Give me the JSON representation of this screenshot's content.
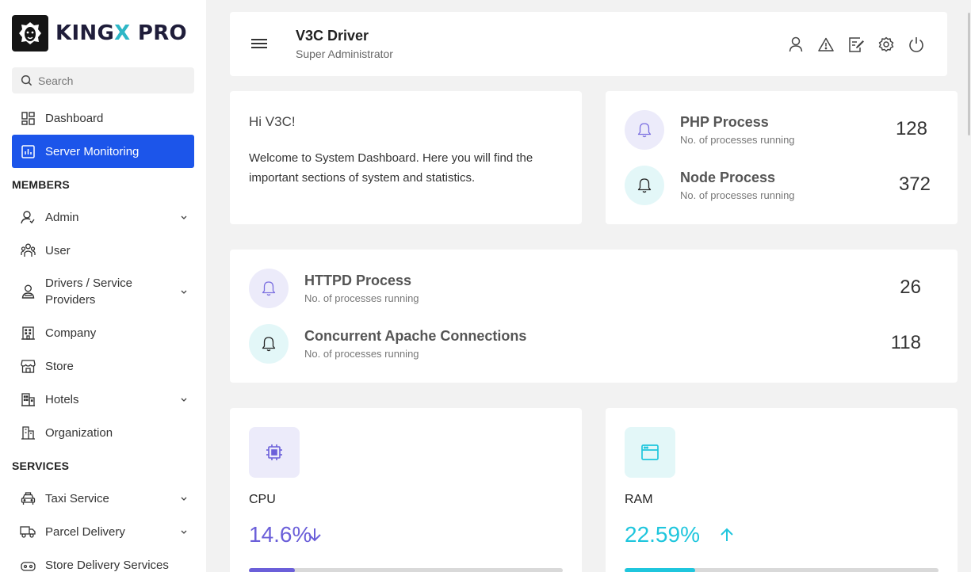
{
  "brand": {
    "name_part1": "KING",
    "name_part2": "X",
    "name_part3": " PRO"
  },
  "search": {
    "placeholder": "Search"
  },
  "sidebar": {
    "items": [
      {
        "label": "Dashboard",
        "icon": "dashboard-icon"
      },
      {
        "label": "Server Monitoring",
        "icon": "chart-icon",
        "active": true
      }
    ],
    "members_title": "MEMBERS",
    "members": [
      {
        "label": "Admin",
        "icon": "admin-icon",
        "expandable": true
      },
      {
        "label": "User",
        "icon": "users-icon"
      },
      {
        "label_line1": "Drivers / Service",
        "label_line2": "Providers",
        "icon": "driver-icon",
        "expandable": true
      },
      {
        "label": "Company",
        "icon": "building-icon"
      },
      {
        "label": "Store",
        "icon": "store-icon"
      },
      {
        "label": "Hotels",
        "icon": "hotel-icon",
        "expandable": true
      },
      {
        "label": "Organization",
        "icon": "organization-icon"
      }
    ],
    "services_title": "SERVICES",
    "services": [
      {
        "label": "Taxi Service",
        "icon": "taxi-icon",
        "expandable": true
      },
      {
        "label": "Parcel Delivery",
        "icon": "truck-icon",
        "expandable": true
      },
      {
        "label": "Store Delivery Services",
        "icon": "delivery-icon",
        "expandable": true
      }
    ]
  },
  "header": {
    "user_name": "V3C Driver",
    "user_role": "Super Administrator",
    "icons": [
      "profile-icon",
      "alert-icon",
      "edit-icon",
      "settings-icon",
      "power-icon"
    ]
  },
  "welcome": {
    "greeting": "Hi V3C!",
    "message": "Welcome to System Dashboard. Here you will find the important sections of system and statistics."
  },
  "processes": [
    {
      "title": "PHP Process",
      "subtitle": "No. of processes running",
      "value": "128",
      "color": "#7b6fe0"
    },
    {
      "title": "Node Process",
      "subtitle": "No. of processes running",
      "value": "372",
      "color": "#2eb7c6"
    },
    {
      "title": "HTTPD Process",
      "subtitle": "No. of processes running",
      "value": "26",
      "color": "#7b6fe0"
    },
    {
      "title": "Concurrent Apache Connections",
      "subtitle": "No. of processes running",
      "value": "118",
      "color": "#2eb7c6"
    }
  ],
  "stats": [
    {
      "label": "CPU",
      "value": "14.6%",
      "trend": "down",
      "percent": 14.6,
      "color": "#6b5fd9",
      "icon_bg": "#ecebfa",
      "icon": "cpu-icon"
    },
    {
      "label": "RAM",
      "value": "22.59%",
      "trend": "up",
      "percent": 22.59,
      "color": "#1fc6dd",
      "icon_bg": "#e3f7f8",
      "icon": "browser-window-icon"
    }
  ]
}
